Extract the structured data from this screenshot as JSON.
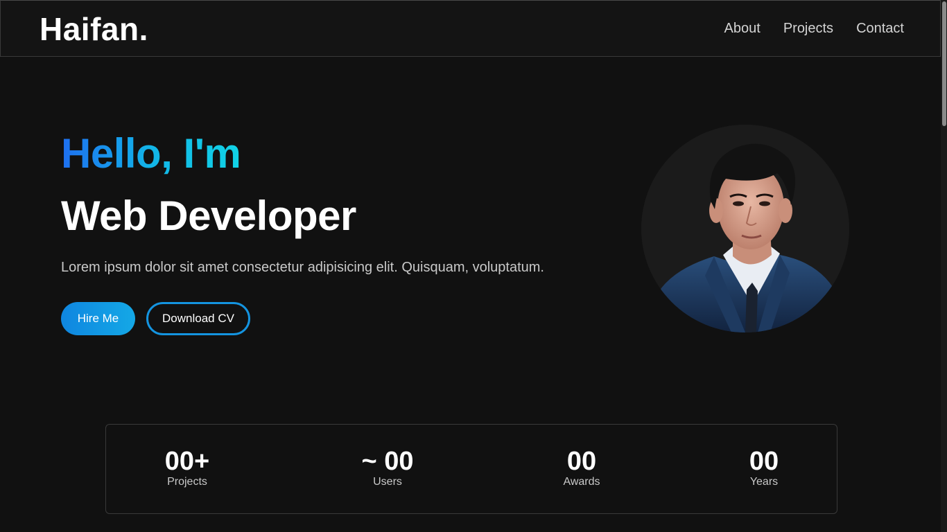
{
  "navbar": {
    "logo": "Haifan.",
    "links": [
      "About",
      "Projects",
      "Contact"
    ]
  },
  "hero": {
    "greeting": "Hello, I'm",
    "role": "Web Developer",
    "description": "Lorem ipsum dolor sit amet consectetur adipisicing elit. Quisquam, voluptatum.",
    "primary_button": "Hire Me",
    "secondary_button": "Download CV"
  },
  "stats": [
    {
      "value": "00+",
      "label": "Projects"
    },
    {
      "value": "~ 00",
      "label": "Users"
    },
    {
      "value": "00",
      "label": "Awards"
    },
    {
      "value": "00",
      "label": "Years"
    }
  ],
  "colors": {
    "background": "#111111",
    "accent_start": "#1e6ff0",
    "accent_end": "#11d3e6",
    "button": "#0f86e0"
  }
}
